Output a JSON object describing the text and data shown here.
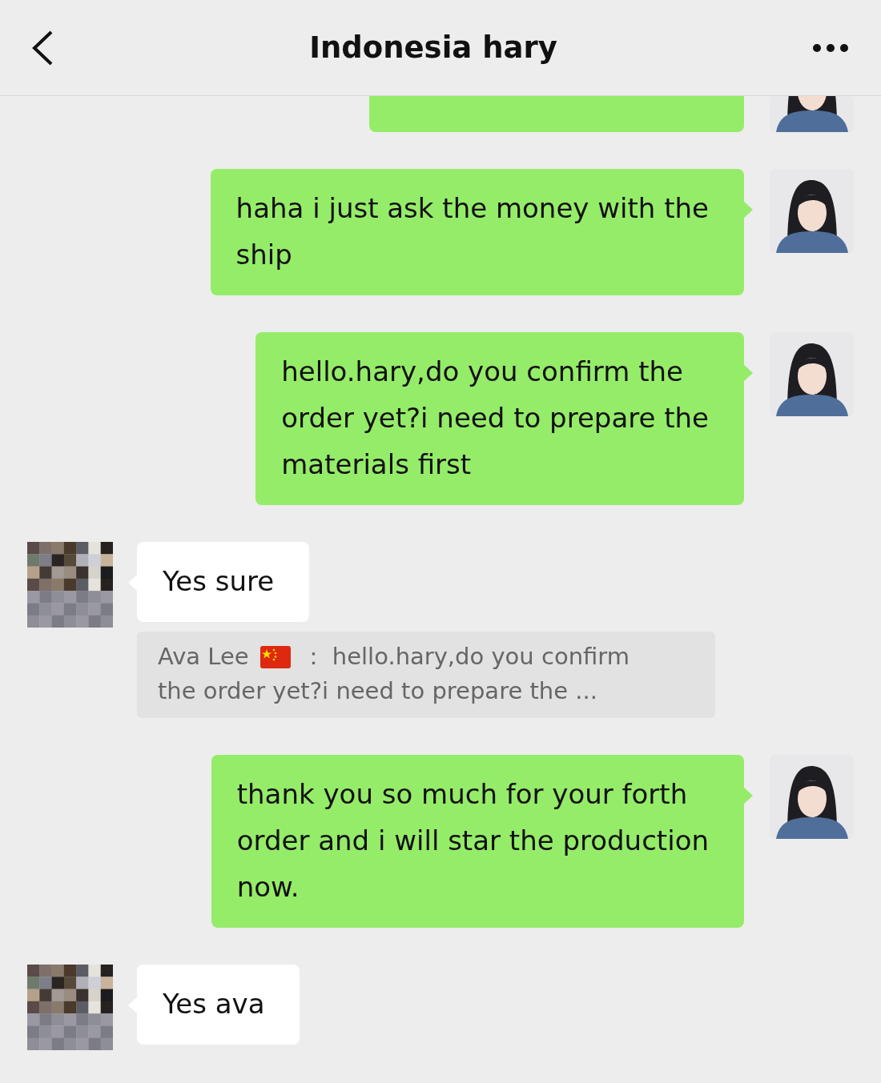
{
  "header": {
    "title": "Indonesia hary"
  },
  "messages": [
    {
      "kind": "clipped",
      "outgoing": true
    },
    {
      "kind": "text",
      "outgoing": true,
      "lines": [
        "haha i just ask the money with the",
        "ship"
      ]
    },
    {
      "kind": "text",
      "outgoing": true,
      "lines": [
        "hello.hary,do you confirm the",
        "order yet?i need to prepare the",
        "materials first"
      ]
    },
    {
      "kind": "text",
      "outgoing": false,
      "lines": [
        "Yes sure"
      ],
      "quote": {
        "sender": "Ava Lee",
        "text": "： hello.hary,do you confirm",
        "text_2": "the order yet?i need to prepare the ..."
      }
    },
    {
      "kind": "text",
      "outgoing": true,
      "lines": [
        "thank you so much for your forth",
        "order and i will star the production",
        "now."
      ]
    },
    {
      "kind": "text",
      "outgoing": false,
      "lines": [
        "Yes ava"
      ]
    }
  ]
}
